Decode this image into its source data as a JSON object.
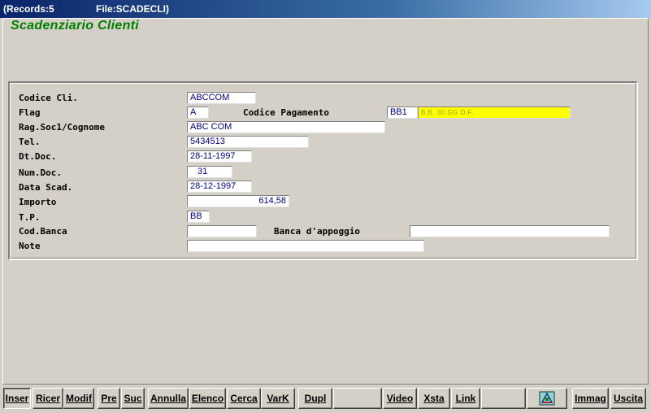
{
  "titlebar": {
    "records": "(Records:5",
    "file": "File:SCADECLI)"
  },
  "app_title": "Scadenziario Clienti",
  "form": {
    "codice_cli": {
      "label": "Codice Cli.",
      "value": "ABCCOM"
    },
    "flag": {
      "label": "Flag",
      "value": "A"
    },
    "codice_pagamento": {
      "label": "Codice Pagamento",
      "value": "BB1",
      "description": "B.B. 30 GG D.F."
    },
    "rag_soc": {
      "label": "Rag.Soc1/Cognome",
      "value": "ABC COM"
    },
    "tel": {
      "label": "Tel.",
      "value": "5434513"
    },
    "dt_doc": {
      "label": "Dt.Doc.",
      "value": "28-11-1997"
    },
    "num_doc": {
      "label": "Num.Doc.",
      "value": "31"
    },
    "data_scad": {
      "label": "Data Scad.",
      "value": "28-12-1997"
    },
    "importo": {
      "label": "Importo",
      "value": "614,58"
    },
    "tp": {
      "label": "T.P.",
      "value": "BB"
    },
    "cod_banca": {
      "label": "Cod.Banca",
      "value": ""
    },
    "banca_appoggio": {
      "label": "Banca d'appoggio",
      "value": ""
    },
    "note": {
      "label": "Note",
      "value": ""
    }
  },
  "toolbar": {
    "inser": "Inser",
    "ricer": "Ricer",
    "modif": "Modif",
    "pre": "Pre",
    "suc": "Suc",
    "annulla": "Annulla",
    "elenco": "Elenco",
    "cerca": "Cerca",
    "vark": "VarK",
    "dupl": "Dupl",
    "video": "Video",
    "xsta": "Xsta",
    "link": "Link",
    "immag": "Immag",
    "uscita": "Uscita",
    "tool_icon": "drafting-cube-icon"
  }
}
